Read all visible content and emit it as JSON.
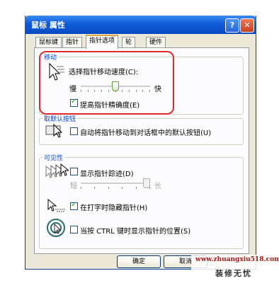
{
  "window": {
    "title": "鼠标 属性",
    "help": "?",
    "close": "✕"
  },
  "tabs": [
    {
      "label": "鼠标键"
    },
    {
      "label": "指针"
    },
    {
      "label": "指针选项",
      "active": true
    },
    {
      "label": "轮"
    },
    {
      "label": "硬件"
    }
  ],
  "motion": {
    "group": "移动",
    "speed_label": "选择指针移动速度(C):",
    "slow": "慢",
    "fast": "快",
    "speed_value": 0.5,
    "enhance_label": "提高指针精确度(E)",
    "enhance_checked": true
  },
  "snap": {
    "group": "取默认按钮",
    "label": "自动将指针移动到对话框中的默认按钮(U)",
    "checked": false
  },
  "visibility": {
    "group": "可见性",
    "trails_label": "显示指针踪迹(D)",
    "trails_checked": false,
    "short": "短",
    "long": "长",
    "trails_value": 1.0,
    "hide_label": "在打字时隐藏指针(H)",
    "hide_checked": true,
    "ctrl_label": "当按 CTRL 键时显示指针的位置(S)",
    "ctrl_checked": false
  },
  "buttons": {
    "ok": "确定",
    "cancel": "取消"
  },
  "watermark": {
    "url": "www.zhuangxiu518.com",
    "name": "装修无忧"
  },
  "colors": {
    "title_bar": "#0f5bd6",
    "group_label": "#0046d5",
    "highlight": "#e0282a"
  }
}
